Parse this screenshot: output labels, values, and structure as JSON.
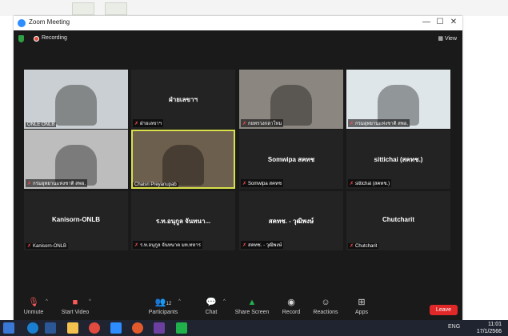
{
  "window": {
    "title": "Zoom Meeting",
    "min": "—",
    "max": "☐",
    "close": "✕"
  },
  "topbar": {
    "recording_label": "Recording",
    "view_label": "View"
  },
  "tiles": [
    {
      "name": "ONLE ONLB",
      "center": "",
      "kind": "video",
      "bg": "#c9cfd2",
      "muted": false
    },
    {
      "name": "ฝ่ายเลขาฯ",
      "center": "ฝ่ายเลขาฯ",
      "kind": "name",
      "muted": true
    },
    {
      "name": "กยทรวงกลาโหม",
      "center": "",
      "kind": "video",
      "bg": "#8b8680",
      "muted": true
    },
    {
      "name": "กรมอุทยานแห่งชาติ สพอ.",
      "center": "",
      "kind": "video",
      "bg": "#dfe6ea",
      "muted": true
    },
    {
      "name": "กรมอุทยานแห่งชาติ สพอ.",
      "center": "",
      "kind": "video",
      "bg": "#bdbdbd",
      "muted": true
    },
    {
      "name": "Chaisri Preyanupab",
      "center": "",
      "kind": "video",
      "bg": "#6d5f4d",
      "muted": false
    },
    {
      "name": "Somwipa สคทช",
      "center": "Somwipa สคทช",
      "kind": "name",
      "muted": true
    },
    {
      "name": "sittichai (สคทช.)",
      "center": "sittichai (สคทช.)",
      "kind": "name",
      "muted": true
    },
    {
      "name": "Kanisorn-ONLB",
      "center": "Kanisorn-ONLB",
      "kind": "name",
      "muted": true
    },
    {
      "name": "ร.ท.อนุกูล จันทนาต มท.ทหาร",
      "center": "ร.ท.อนุกูล จันทนา...",
      "kind": "name",
      "muted": true
    },
    {
      "name": "สคทช. - วุฒิพงษ์",
      "center": "สคทช. - วุฒิพงษ์",
      "kind": "name",
      "muted": true
    },
    {
      "name": "Chutcharit",
      "center": "Chutcharit",
      "kind": "name",
      "muted": true
    }
  ],
  "toolbar": {
    "unmute": "Unmute",
    "start_video": "Start Video",
    "participants": "Participants",
    "participants_count": "12",
    "chat": "Chat",
    "share_screen": "Share Screen",
    "record": "Record",
    "reactions": "Reactions",
    "apps": "Apps",
    "leave": "Leave"
  },
  "taskbar": {
    "language": "ENG",
    "time": "11:01",
    "date": "17/1/2566"
  },
  "colors": {
    "accent": "#2d8cff",
    "share_green": "#23b14d",
    "leave_red": "#e02828",
    "active_speaker": "#d8e04a"
  }
}
